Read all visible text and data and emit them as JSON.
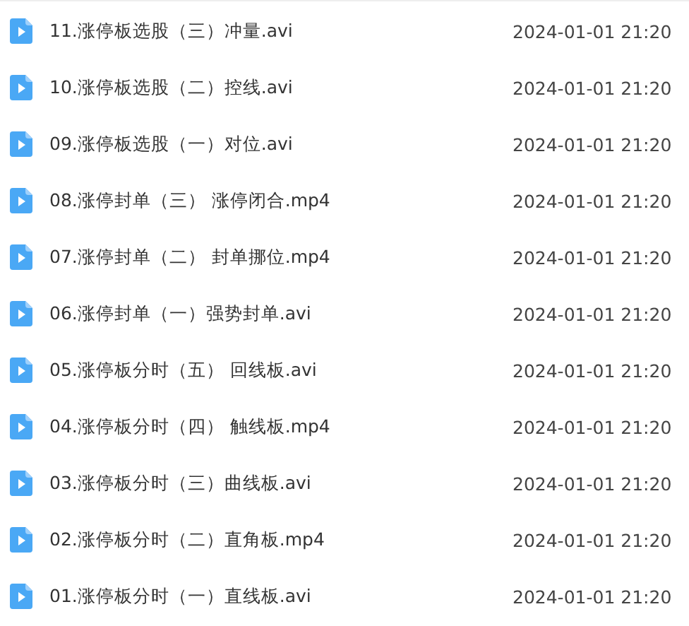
{
  "files": [
    {
      "name": "11.涨停板选股（三）冲量.avi",
      "modified": "2024-01-01 21:20"
    },
    {
      "name": "10.涨停板选股（二）控线.avi",
      "modified": "2024-01-01 21:20"
    },
    {
      "name": "09.涨停板选股（一）对位.avi",
      "modified": "2024-01-01 21:20"
    },
    {
      "name": "08.涨停封单（三） 涨停闭合.mp4",
      "modified": "2024-01-01 21:20"
    },
    {
      "name": "07.涨停封单（二） 封单挪位.mp4",
      "modified": "2024-01-01 21:20"
    },
    {
      "name": "06.涨停封单（一）强势封单.avi",
      "modified": "2024-01-01 21:20"
    },
    {
      "name": "05.涨停板分时（五） 回线板.avi",
      "modified": "2024-01-01 21:20"
    },
    {
      "name": "04.涨停板分时（四） 触线板.mp4",
      "modified": "2024-01-01 21:20"
    },
    {
      "name": "03.涨停板分时（三）曲线板.avi",
      "modified": "2024-01-01 21:20"
    },
    {
      "name": "02.涨停板分时（二）直角板.mp4",
      "modified": "2024-01-01 21:20"
    },
    {
      "name": "01.涨停板分时（一）直线板.avi",
      "modified": "2024-01-01 21:20"
    }
  ]
}
